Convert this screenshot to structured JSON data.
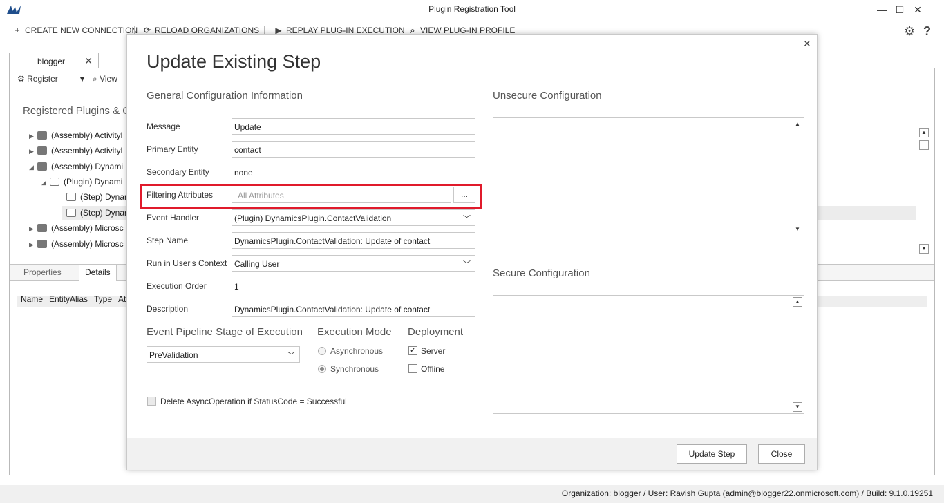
{
  "window": {
    "title": "Plugin Registration Tool",
    "minimize_glyph": "—",
    "maximize_glyph": "☐",
    "close_glyph": "✕"
  },
  "toolbar": {
    "create_label": "CREATE NEW CONNECTION",
    "reload_label": "RELOAD ORGANIZATIONS",
    "replay_label": "REPLAY PLUG-IN EXECUTION",
    "profile_label": "VIEW PLUG-IN PROFILE"
  },
  "tab": {
    "label": "blogger"
  },
  "subtoolbar": {
    "register_label": "Register",
    "view_label": "View"
  },
  "tree": {
    "title": "Registered Plugins & C",
    "items": [
      {
        "label": "(Assembly) Activityl"
      },
      {
        "label": "(Assembly) Activityl"
      },
      {
        "label": "(Assembly) Dynami"
      },
      {
        "label": "(Plugin) Dynami"
      },
      {
        "label": "(Step) Dynar"
      },
      {
        "label": "(Step) Dynar"
      },
      {
        "label": "(Assembly) Microsc"
      },
      {
        "label": "(Assembly) Microsc"
      }
    ]
  },
  "lower_tabs": {
    "properties": "Properties",
    "details": "Details"
  },
  "grid_columns": [
    "Name",
    "EntityAlias",
    "Type",
    "At"
  ],
  "status": {
    "text": "Organization: blogger / User: Ravish Gupta (admin@blogger22.onmicrosoft.com) / Build: 9.1.0.19251"
  },
  "dialog": {
    "title": "Update Existing Step",
    "general_section": "General Configuration Information",
    "unsecure_section": "Unsecure  Configuration",
    "secure_section": "Secure  Configuration",
    "fields": {
      "message": {
        "label": "Message",
        "value": "Update"
      },
      "primary_entity": {
        "label": "Primary Entity",
        "value": "contact"
      },
      "secondary_entity": {
        "label": "Secondary Entity",
        "value": "none"
      },
      "filtering_attributes": {
        "label": "Filtering Attributes",
        "placeholder": "All Attributes",
        "button": "..."
      },
      "event_handler": {
        "label": "Event Handler",
        "value": "(Plugin) DynamicsPlugin.ContactValidation"
      },
      "step_name": {
        "label": "Step Name",
        "value": "DynamicsPlugin.ContactValidation: Update of contact"
      },
      "run_context": {
        "label": "Run in User's Context",
        "value": "Calling User"
      },
      "execution_order": {
        "label": "Execution Order",
        "value": "1"
      },
      "description": {
        "label": "Description",
        "value": "DynamicsPlugin.ContactValidation: Update of contact"
      }
    },
    "pipeline": {
      "label": "Event Pipeline Stage of Execution",
      "value": "PreValidation"
    },
    "execution_mode": {
      "label": "Execution Mode",
      "options": [
        {
          "label": "Asynchronous",
          "checked": false
        },
        {
          "label": "Synchronous",
          "checked": true
        }
      ]
    },
    "deployment": {
      "label": "Deployment",
      "options": [
        {
          "label": "Server",
          "checked": true
        },
        {
          "label": "Offline",
          "checked": false
        }
      ]
    },
    "delete_async": {
      "label": "Delete AsyncOperation if StatusCode = Successful",
      "checked": false
    },
    "buttons": {
      "update": "Update Step",
      "close": "Close"
    },
    "close_glyph": "✕",
    "colors": {
      "highlight": "#e01a2b",
      "footer": "#f1f1f1"
    }
  }
}
